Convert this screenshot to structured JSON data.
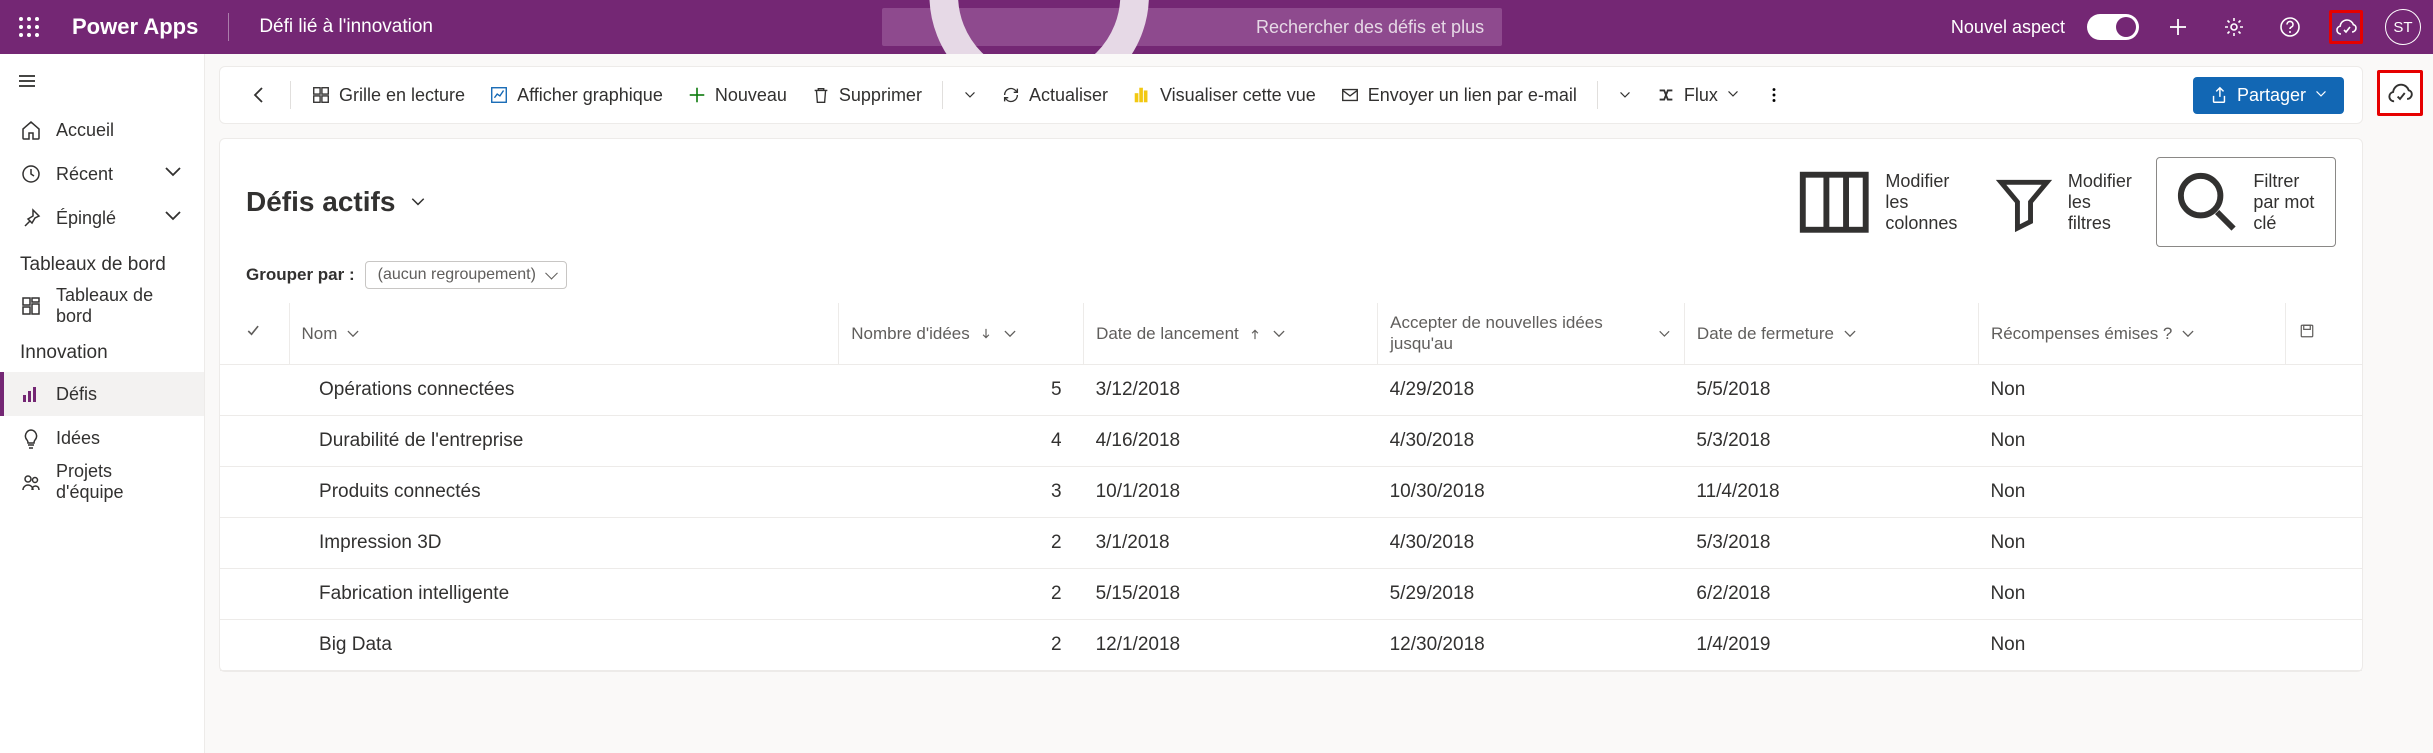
{
  "topbar": {
    "app_name": "Power Apps",
    "subtitle": "Défi lié à l'innovation",
    "search_placeholder": "Rechercher des défis et plus",
    "aspect_label": "Nouvel aspect",
    "initials": "ST"
  },
  "sidebar": {
    "accueil": "Accueil",
    "recent": "Récent",
    "epingle": "Épinglé",
    "section_tableaux": "Tableaux de bord",
    "tableaux": "Tableaux de bord",
    "section_innovation": "Innovation",
    "defis": "Défis",
    "idees": "Idées",
    "projets": "Projets d'équipe"
  },
  "cmdbar": {
    "grille": "Grille en lecture",
    "graphique": "Afficher graphique",
    "nouveau": "Nouveau",
    "supprimer": "Supprimer",
    "actualiser": "Actualiser",
    "visualiser": "Visualiser cette vue",
    "envoyer": "Envoyer un lien par e-mail",
    "flux": "Flux",
    "partager": "Partager"
  },
  "view": {
    "title": "Défis actifs",
    "modifier_colonnes": "Modifier les colonnes",
    "modifier_filtres": "Modifier les filtres",
    "filtrer_mot": "Filtrer par mot clé",
    "grouper_label": "Grouper par :",
    "grouper_value": "(aucun regroupement)"
  },
  "columns": {
    "nom": "Nom",
    "idees": "Nombre d'idées",
    "lancement": "Date de lancement",
    "accepter": "Accepter de nouvelles idées jusqu'au",
    "fermeture": "Date de fermeture",
    "recompenses": "Récompenses émises ?"
  },
  "rows": [
    {
      "nom": "Opérations connectées",
      "idees": "5",
      "lancement": "3/12/2018",
      "accepter": "4/29/2018",
      "fermeture": "5/5/2018",
      "reward": "Non"
    },
    {
      "nom": "Durabilité de l'entreprise",
      "idees": "4",
      "lancement": "4/16/2018",
      "accepter": "4/30/2018",
      "fermeture": "5/3/2018",
      "reward": "Non"
    },
    {
      "nom": "Produits connectés",
      "idees": "3",
      "lancement": "10/1/2018",
      "accepter": "10/30/2018",
      "fermeture": "11/4/2018",
      "reward": "Non"
    },
    {
      "nom": "Impression 3D",
      "idees": "2",
      "lancement": "3/1/2018",
      "accepter": "4/30/2018",
      "fermeture": "5/3/2018",
      "reward": "Non"
    },
    {
      "nom": "Fabrication intelligente",
      "idees": "2",
      "lancement": "5/15/2018",
      "accepter": "5/29/2018",
      "fermeture": "6/2/2018",
      "reward": "Non"
    },
    {
      "nom": "Big Data",
      "idees": "2",
      "lancement": "12/1/2018",
      "accepter": "12/30/2018",
      "fermeture": "1/4/2019",
      "reward": "Non"
    }
  ]
}
